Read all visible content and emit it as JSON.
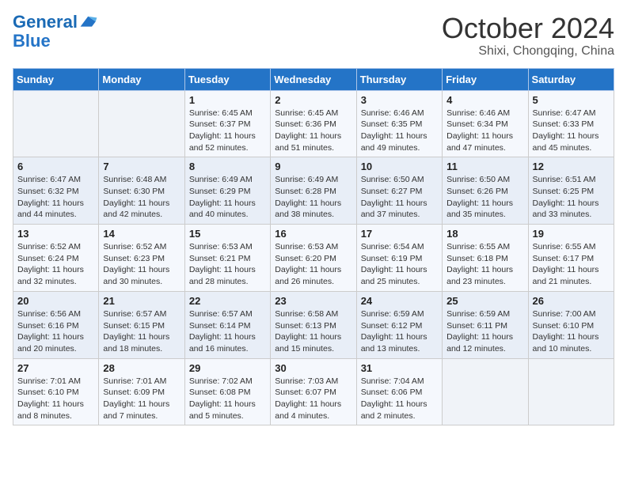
{
  "header": {
    "logo_line1": "General",
    "logo_line2": "Blue",
    "month_title": "October 2024",
    "location": "Shixi, Chongqing, China"
  },
  "weekdays": [
    "Sunday",
    "Monday",
    "Tuesday",
    "Wednesday",
    "Thursday",
    "Friday",
    "Saturday"
  ],
  "weeks": [
    [
      {
        "day": "",
        "sunrise": "",
        "sunset": "",
        "daylight": ""
      },
      {
        "day": "",
        "sunrise": "",
        "sunset": "",
        "daylight": ""
      },
      {
        "day": "1",
        "sunrise": "Sunrise: 6:45 AM",
        "sunset": "Sunset: 6:37 PM",
        "daylight": "Daylight: 11 hours and 52 minutes."
      },
      {
        "day": "2",
        "sunrise": "Sunrise: 6:45 AM",
        "sunset": "Sunset: 6:36 PM",
        "daylight": "Daylight: 11 hours and 51 minutes."
      },
      {
        "day": "3",
        "sunrise": "Sunrise: 6:46 AM",
        "sunset": "Sunset: 6:35 PM",
        "daylight": "Daylight: 11 hours and 49 minutes."
      },
      {
        "day": "4",
        "sunrise": "Sunrise: 6:46 AM",
        "sunset": "Sunset: 6:34 PM",
        "daylight": "Daylight: 11 hours and 47 minutes."
      },
      {
        "day": "5",
        "sunrise": "Sunrise: 6:47 AM",
        "sunset": "Sunset: 6:33 PM",
        "daylight": "Daylight: 11 hours and 45 minutes."
      }
    ],
    [
      {
        "day": "6",
        "sunrise": "Sunrise: 6:47 AM",
        "sunset": "Sunset: 6:32 PM",
        "daylight": "Daylight: 11 hours and 44 minutes."
      },
      {
        "day": "7",
        "sunrise": "Sunrise: 6:48 AM",
        "sunset": "Sunset: 6:30 PM",
        "daylight": "Daylight: 11 hours and 42 minutes."
      },
      {
        "day": "8",
        "sunrise": "Sunrise: 6:49 AM",
        "sunset": "Sunset: 6:29 PM",
        "daylight": "Daylight: 11 hours and 40 minutes."
      },
      {
        "day": "9",
        "sunrise": "Sunrise: 6:49 AM",
        "sunset": "Sunset: 6:28 PM",
        "daylight": "Daylight: 11 hours and 38 minutes."
      },
      {
        "day": "10",
        "sunrise": "Sunrise: 6:50 AM",
        "sunset": "Sunset: 6:27 PM",
        "daylight": "Daylight: 11 hours and 37 minutes."
      },
      {
        "day": "11",
        "sunrise": "Sunrise: 6:50 AM",
        "sunset": "Sunset: 6:26 PM",
        "daylight": "Daylight: 11 hours and 35 minutes."
      },
      {
        "day": "12",
        "sunrise": "Sunrise: 6:51 AM",
        "sunset": "Sunset: 6:25 PM",
        "daylight": "Daylight: 11 hours and 33 minutes."
      }
    ],
    [
      {
        "day": "13",
        "sunrise": "Sunrise: 6:52 AM",
        "sunset": "Sunset: 6:24 PM",
        "daylight": "Daylight: 11 hours and 32 minutes."
      },
      {
        "day": "14",
        "sunrise": "Sunrise: 6:52 AM",
        "sunset": "Sunset: 6:23 PM",
        "daylight": "Daylight: 11 hours and 30 minutes."
      },
      {
        "day": "15",
        "sunrise": "Sunrise: 6:53 AM",
        "sunset": "Sunset: 6:21 PM",
        "daylight": "Daylight: 11 hours and 28 minutes."
      },
      {
        "day": "16",
        "sunrise": "Sunrise: 6:53 AM",
        "sunset": "Sunset: 6:20 PM",
        "daylight": "Daylight: 11 hours and 26 minutes."
      },
      {
        "day": "17",
        "sunrise": "Sunrise: 6:54 AM",
        "sunset": "Sunset: 6:19 PM",
        "daylight": "Daylight: 11 hours and 25 minutes."
      },
      {
        "day": "18",
        "sunrise": "Sunrise: 6:55 AM",
        "sunset": "Sunset: 6:18 PM",
        "daylight": "Daylight: 11 hours and 23 minutes."
      },
      {
        "day": "19",
        "sunrise": "Sunrise: 6:55 AM",
        "sunset": "Sunset: 6:17 PM",
        "daylight": "Daylight: 11 hours and 21 minutes."
      }
    ],
    [
      {
        "day": "20",
        "sunrise": "Sunrise: 6:56 AM",
        "sunset": "Sunset: 6:16 PM",
        "daylight": "Daylight: 11 hours and 20 minutes."
      },
      {
        "day": "21",
        "sunrise": "Sunrise: 6:57 AM",
        "sunset": "Sunset: 6:15 PM",
        "daylight": "Daylight: 11 hours and 18 minutes."
      },
      {
        "day": "22",
        "sunrise": "Sunrise: 6:57 AM",
        "sunset": "Sunset: 6:14 PM",
        "daylight": "Daylight: 11 hours and 16 minutes."
      },
      {
        "day": "23",
        "sunrise": "Sunrise: 6:58 AM",
        "sunset": "Sunset: 6:13 PM",
        "daylight": "Daylight: 11 hours and 15 minutes."
      },
      {
        "day": "24",
        "sunrise": "Sunrise: 6:59 AM",
        "sunset": "Sunset: 6:12 PM",
        "daylight": "Daylight: 11 hours and 13 minutes."
      },
      {
        "day": "25",
        "sunrise": "Sunrise: 6:59 AM",
        "sunset": "Sunset: 6:11 PM",
        "daylight": "Daylight: 11 hours and 12 minutes."
      },
      {
        "day": "26",
        "sunrise": "Sunrise: 7:00 AM",
        "sunset": "Sunset: 6:10 PM",
        "daylight": "Daylight: 11 hours and 10 minutes."
      }
    ],
    [
      {
        "day": "27",
        "sunrise": "Sunrise: 7:01 AM",
        "sunset": "Sunset: 6:10 PM",
        "daylight": "Daylight: 11 hours and 8 minutes."
      },
      {
        "day": "28",
        "sunrise": "Sunrise: 7:01 AM",
        "sunset": "Sunset: 6:09 PM",
        "daylight": "Daylight: 11 hours and 7 minutes."
      },
      {
        "day": "29",
        "sunrise": "Sunrise: 7:02 AM",
        "sunset": "Sunset: 6:08 PM",
        "daylight": "Daylight: 11 hours and 5 minutes."
      },
      {
        "day": "30",
        "sunrise": "Sunrise: 7:03 AM",
        "sunset": "Sunset: 6:07 PM",
        "daylight": "Daylight: 11 hours and 4 minutes."
      },
      {
        "day": "31",
        "sunrise": "Sunrise: 7:04 AM",
        "sunset": "Sunset: 6:06 PM",
        "daylight": "Daylight: 11 hours and 2 minutes."
      },
      {
        "day": "",
        "sunrise": "",
        "sunset": "",
        "daylight": ""
      },
      {
        "day": "",
        "sunrise": "",
        "sunset": "",
        "daylight": ""
      }
    ]
  ]
}
